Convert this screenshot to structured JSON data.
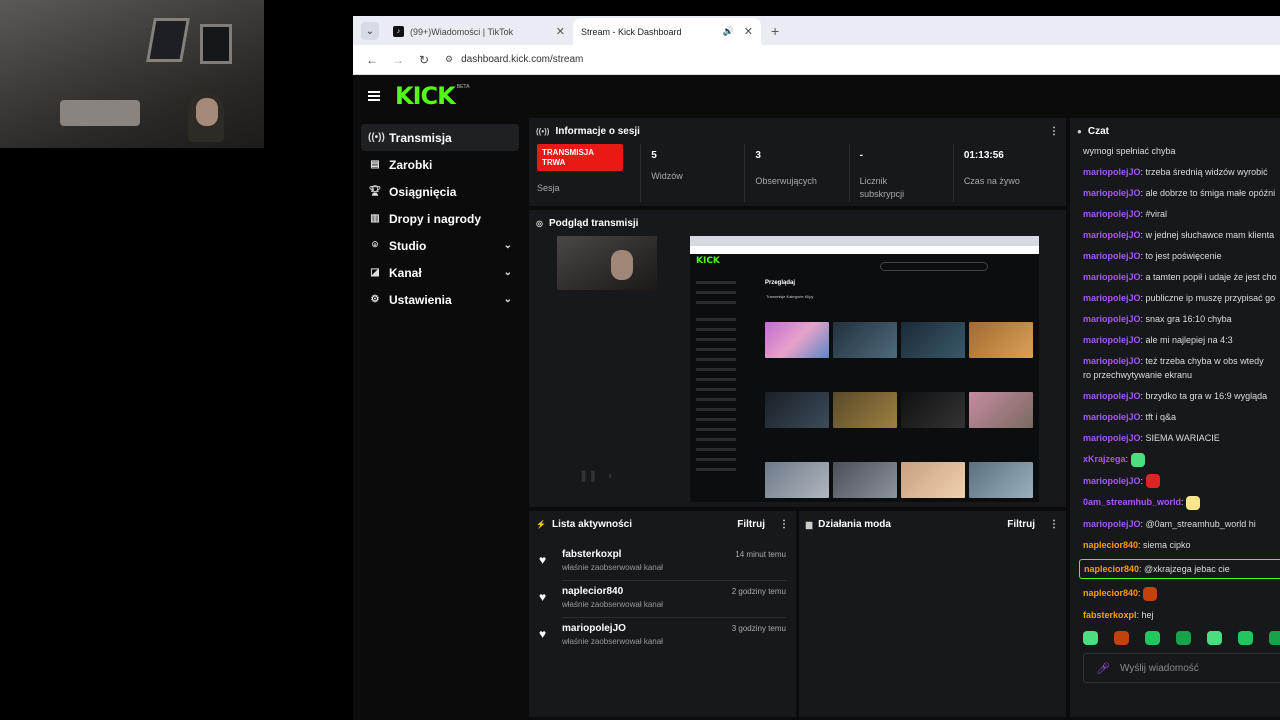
{
  "browser": {
    "tabs": [
      {
        "title": "(99+)Wiadomości | TikTok",
        "favicon": "tiktok-icon"
      },
      {
        "title": "Stream - Kick Dashboard",
        "favicon": "kick-icon"
      }
    ],
    "url": "dashboard.kick.com/stream"
  },
  "brand": {
    "logo": "KICK",
    "beta": "BETA",
    "accent": "#53fc18"
  },
  "sidebar": {
    "items": [
      {
        "label": "Transmisja"
      },
      {
        "label": "Zarobki"
      },
      {
        "label": "Osiągnięcia"
      },
      {
        "label": "Dropy i nagrody"
      },
      {
        "label": "Studio"
      },
      {
        "label": "Kanał"
      },
      {
        "label": "Ustawienia"
      }
    ]
  },
  "session": {
    "title": "Informacje o sesji",
    "badge": "TRANSMISJA TRWA",
    "badge_caption": "Sesja",
    "stats": [
      {
        "value": "5",
        "label": "Widzów"
      },
      {
        "value": "3",
        "label": "Obserwujących"
      },
      {
        "value": "-",
        "label": "Licznik subskrypcji"
      },
      {
        "value": "01:13:56",
        "label": "Czas na żywo"
      }
    ]
  },
  "preview": {
    "title": "Podgląd transmisji",
    "inner_title": "Przeglądaj",
    "inner_tabs": "Transmisje   Kategorie   Klipy"
  },
  "activity": {
    "title": "Lista aktywności",
    "filter": "Filtruj",
    "items": [
      {
        "name": "fabsterkoxpl",
        "sub": "właśnie zaobserwował kanał",
        "time": "14 minut temu"
      },
      {
        "name": "naplecior840",
        "sub": "właśnie zaobserwował kanał",
        "time": "2 godziny temu"
      },
      {
        "name": "mariopolejJO",
        "sub": "właśnie zaobserwował kanał",
        "time": "3 godziny temu"
      }
    ]
  },
  "mod": {
    "title": "Działania moda",
    "filter": "Filtruj"
  },
  "chat": {
    "title": "Czat",
    "messages": [
      {
        "user": "",
        "text": "wymogi spełniać chyba",
        "color": "#a855f7"
      },
      {
        "user": "mariopolejJO",
        "text": "trzeba średnią widzów wyrobić",
        "color": "#a855f7"
      },
      {
        "user": "mariopolejJO",
        "text": "ale dobrze to śmiga małe opóźni",
        "color": "#a855f7"
      },
      {
        "user": "mariopolejJO",
        "text": "#viral",
        "color": "#a855f7"
      },
      {
        "user": "mariopolejJO",
        "text": "w jednej słuchawce mam klienta",
        "color": "#a855f7"
      },
      {
        "user": "mariopolejJO",
        "text": "to jest poświęcenie",
        "color": "#a855f7"
      },
      {
        "user": "mariopolejJO",
        "text": "a tamten popił i udaje że jest cho",
        "color": "#a855f7"
      },
      {
        "user": "mariopolejJO",
        "text": "publiczne ip muszę przypisać go",
        "color": "#a855f7"
      },
      {
        "user": "mariopolejJO",
        "text": "snax gra 16:10 chyba",
        "color": "#a855f7"
      },
      {
        "user": "mariopolejJO",
        "text": "ale mi najlepiej na 4:3",
        "color": "#a855f7"
      },
      {
        "user": "mariopolejJO",
        "text": "też trzeba chyba w obs wtedy ro przechwytywanie ekranu",
        "color": "#a855f7"
      },
      {
        "user": "mariopolejJO",
        "text": "brzydko ta gra w 16:9 wygląda",
        "color": "#a855f7"
      },
      {
        "user": "mariopolejJO",
        "text": "tft i q&a",
        "color": "#a855f7"
      },
      {
        "user": "mariopolejJO",
        "text": "SIEMA WARIACIE",
        "color": "#a855f7"
      },
      {
        "user": "xKrajzega",
        "text": "",
        "color": "#a855f7"
      },
      {
        "user": "mariopolejJO",
        "text": "",
        "color": "#a855f7"
      },
      {
        "user": "0am_streamhub_world",
        "text": "",
        "color": "#a855f7"
      },
      {
        "user": "mariopolejJO",
        "text": "@0am_streamhub_world hi",
        "color": "#a855f7"
      },
      {
        "user": "naplecior840",
        "text": "siema cipko",
        "color": "#f59e0b"
      },
      {
        "user": "naplecior840",
        "text": "@xkrajzega jebac cie",
        "color": "#f59e0b"
      },
      {
        "user": "naplecior840",
        "text": "",
        "color": "#f59e0b"
      },
      {
        "user": "fabsterkoxpl",
        "text": "hej",
        "color": "#f59e0b"
      }
    ],
    "input_placeholder": "Wyślij wiadomość"
  }
}
